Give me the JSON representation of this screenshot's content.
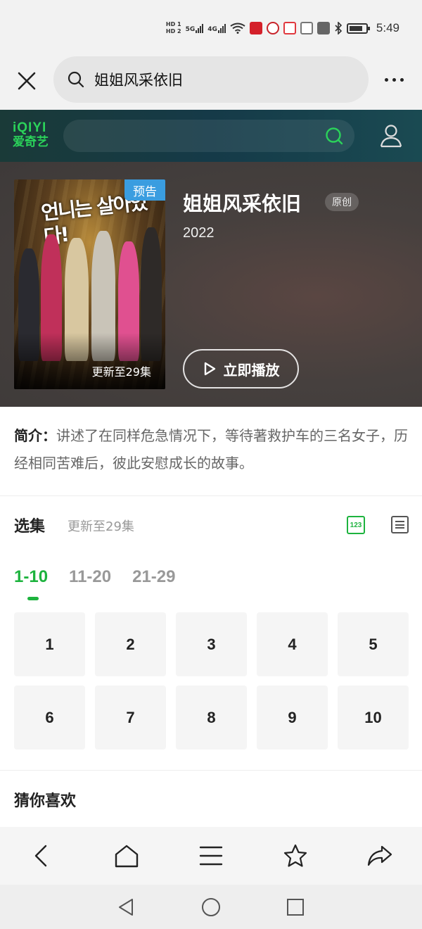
{
  "status_bar": {
    "hd1": "HD 1",
    "hd2": "HD 2",
    "signal1": "5G",
    "signal2": "4G",
    "wifi": "6",
    "time": "5:49"
  },
  "browser": {
    "search_query": "姐姐风采依旧"
  },
  "iqiyi": {
    "logo_line1": "iQIYI",
    "logo_line2": "爱奇艺",
    "search_placeholder": ""
  },
  "show": {
    "title": "姐姐风采依旧",
    "badge": "原创",
    "year": "2022",
    "poster_tag": "预告",
    "poster_update": "更新至29集",
    "poster_art_text": "언니는 살아있다!",
    "play_label": "立即播放"
  },
  "intro": {
    "label": "简介：",
    "text": "讲述了在同样危急情况下，等待著救护车的三名女子，历经相同苦难后，彼此安慰成长的故事。"
  },
  "episodes": {
    "title": "选集",
    "subtitle": "更新至29集",
    "grid_icon_label": "123",
    "ranges": [
      "1-10",
      "11-20",
      "21-29"
    ],
    "active_range": "1-10",
    "items": [
      "1",
      "2",
      "3",
      "4",
      "5",
      "6",
      "7",
      "8",
      "9",
      "10"
    ]
  },
  "recommend": {
    "title": "猜你喜欢"
  },
  "icons": {
    "close": "close-icon",
    "search": "search-icon",
    "more": "more-icon",
    "user": "user-icon",
    "play": "play-icon",
    "back": "back-icon",
    "home": "home-icon",
    "menu": "menu-icon",
    "star": "star-icon",
    "share": "share-icon"
  },
  "colors": {
    "accent_green": "#1db33e",
    "iqiyi_green": "#2bd25a",
    "tag_blue": "#3a9de0"
  }
}
